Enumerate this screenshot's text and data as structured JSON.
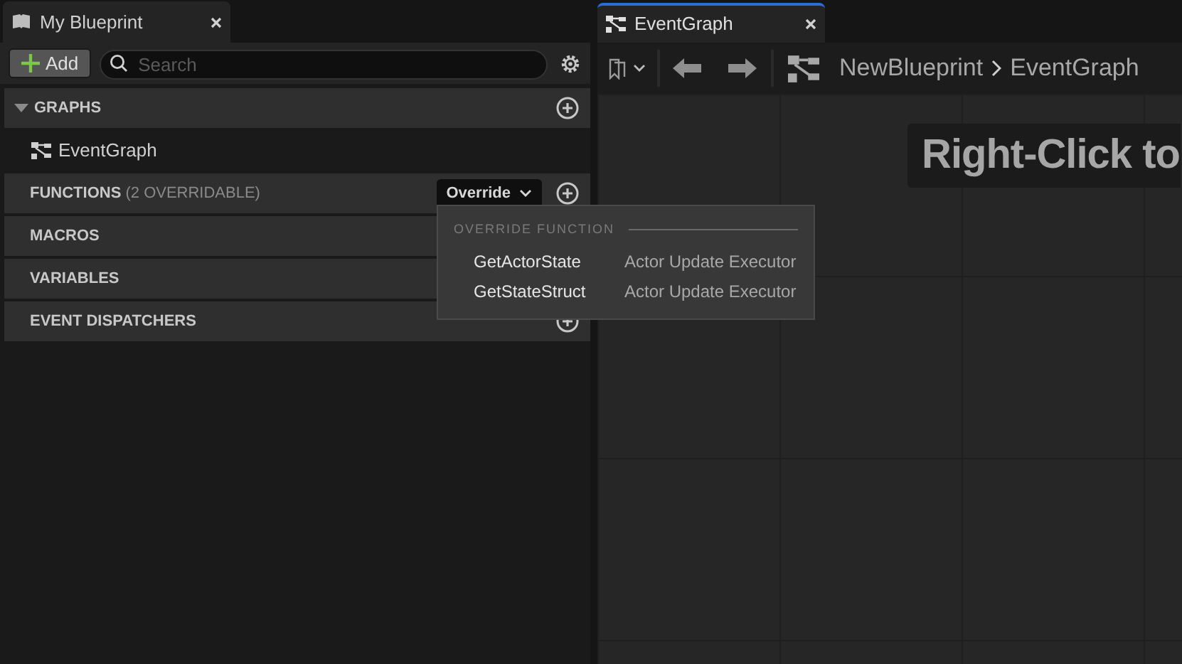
{
  "left_panel": {
    "tab": {
      "title": "My Blueprint"
    },
    "toolbar": {
      "add_button": "Add",
      "search": {
        "placeholder": "Search"
      }
    },
    "sections": [
      {
        "title": "GRAPHS",
        "expanded": true,
        "add_button": true,
        "items": [
          {
            "label": "EventGraph"
          }
        ]
      },
      {
        "title": "FUNCTIONS",
        "note": "(2 OVERRIDABLE)",
        "expanded": false,
        "add_button": true,
        "override_button": "Override"
      },
      {
        "title": "MACROS",
        "expanded": false
      },
      {
        "title": "VARIABLES",
        "expanded": false
      },
      {
        "title": "EVENT DISPATCHERS",
        "expanded": false,
        "add_button": true
      }
    ]
  },
  "override_menu": {
    "heading": "OVERRIDE FUNCTION",
    "items": [
      {
        "name": "GetActorState",
        "source": "Actor Update Executor"
      },
      {
        "name": "GetStateStruct",
        "source": "Actor Update Executor"
      }
    ]
  },
  "graph_panel": {
    "tab": {
      "title": "EventGraph"
    },
    "breadcrumb": [
      "NewBlueprint",
      "EventGraph"
    ],
    "hint": "Right-Click to"
  }
}
